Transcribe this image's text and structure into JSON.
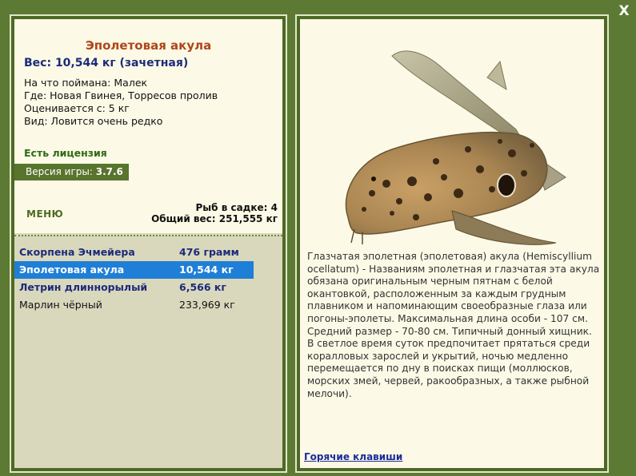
{
  "close": {
    "label": "X"
  },
  "fish": {
    "title": "Эполетовая акула",
    "weight_line": "Вес: 10,544 кг (зачетная)",
    "details": [
      {
        "label": "На что поймана:",
        "value": "Малек"
      },
      {
        "label": "Где:",
        "value": "Новая Гвинея, Торресов пролив"
      },
      {
        "label": "Оценивается с:",
        "value": "5 кг"
      },
      {
        "label": "Вид:",
        "value": "Ловится очень редко"
      }
    ],
    "license": "Есть лицензия"
  },
  "version": {
    "label": "Версия игры:",
    "value": "3.7.6"
  },
  "menu": {
    "label": "МЕНЮ"
  },
  "cage": {
    "count_line": "Рыб в садке: 4",
    "total_line": "Общий вес: 251,555 кг"
  },
  "catch_list": [
    {
      "name": "Скорпена Эчмейера",
      "weight": "476 грамм",
      "style": "bold"
    },
    {
      "name": "Эполетовая акула",
      "weight": "10,544 кг",
      "style": "selected"
    },
    {
      "name": "Летрин длиннорылый",
      "weight": "6,566 кг",
      "style": "bold"
    },
    {
      "name": "Марлин чёрный",
      "weight": "233,969 кг",
      "style": "plain"
    }
  ],
  "description": "Глазчатая эполетная (эполетовая) акула (Hemiscyllium ocellatum) - Названиям эполетная и глазчатая эта акула обязана оригинальным черным пятнам с белой окантовкой, расположенным за каждым грудным плавником и напоминающим своеобразные глаза или погоны-эполеты. Максимальная длина особи - 107 см. Средний размер - 70-80 см. Типичный донный хищник. В светлое время суток предпочитает прятаться среди коралловых зарослей и укрытий, ночью медленно перемещается по дну в поисках пищи (моллюсков, морских змей, червей, ракообразных, а также рыбной мелочи).",
  "hotkeys": {
    "label": "Горячие клавиши"
  },
  "colors": {
    "background": "#5c7a33",
    "title": "#b0461b",
    "accent_blue": "#1c2b7a",
    "selection": "#1f7fd6",
    "license_green": "#2f6a17"
  },
  "icons": {
    "fish_image": "epaulette-shark-image"
  }
}
